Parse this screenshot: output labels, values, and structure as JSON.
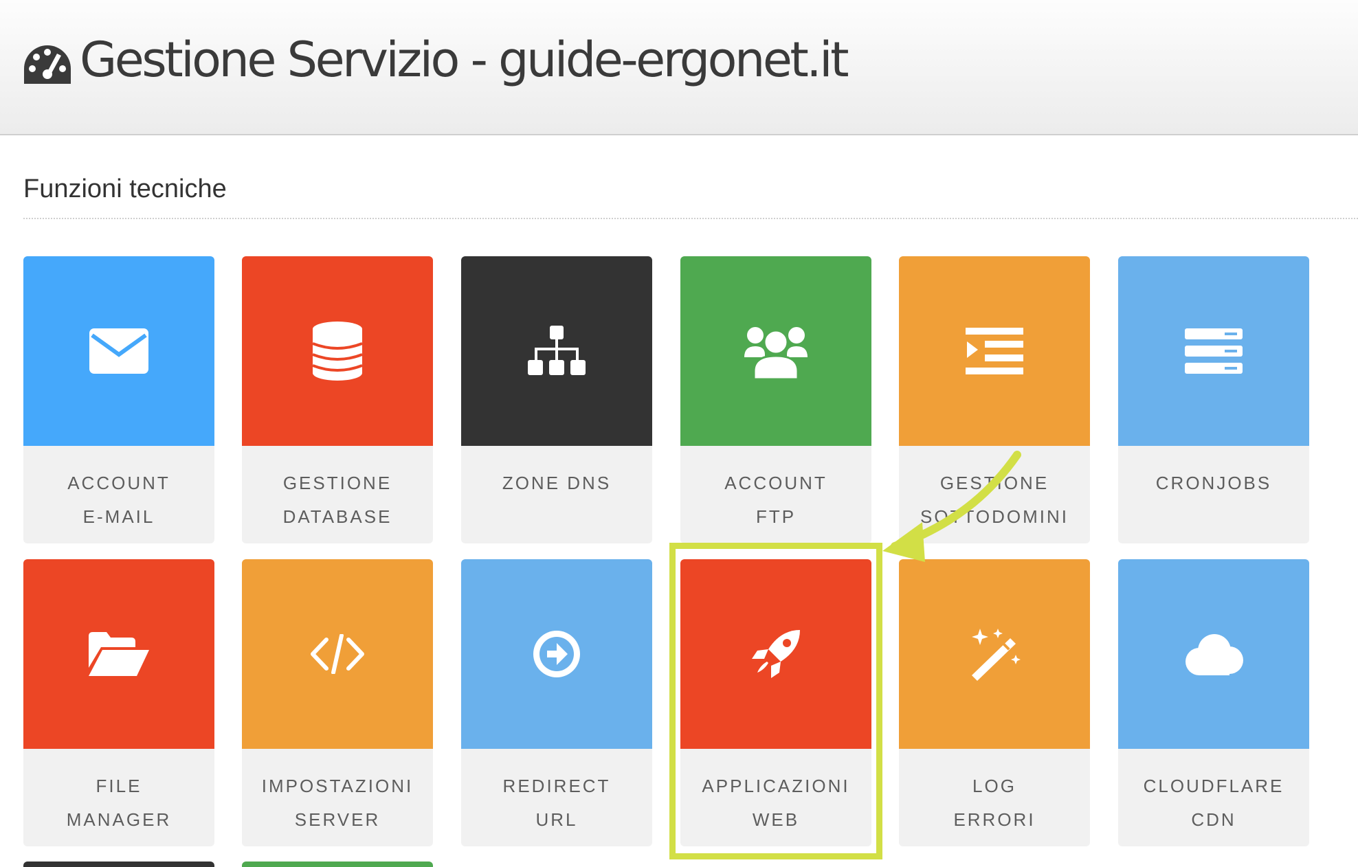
{
  "header": {
    "title": "Gestione Servizio - guide-ergonet.it",
    "icon": "dashboard-icon"
  },
  "section": {
    "title": "Funzioni tecniche"
  },
  "tiles": [
    {
      "id": "account-email",
      "icon": "envelope-icon",
      "color": "#45a8fb",
      "lines": [
        "ACCOUNT",
        "E-MAIL"
      ]
    },
    {
      "id": "gestione-database",
      "icon": "database-icon",
      "color": "#ec4625",
      "lines": [
        "GESTIONE",
        "DATABASE"
      ]
    },
    {
      "id": "zone-dns",
      "icon": "sitemap-icon",
      "color": "#333333",
      "lines": [
        "ZONE DNS",
        ""
      ]
    },
    {
      "id": "account-ftp",
      "icon": "users-icon",
      "color": "#4fa950",
      "lines": [
        "ACCOUNT",
        "FTP"
      ]
    },
    {
      "id": "gestione-sottodomini",
      "icon": "indent-icon",
      "color": "#f09f38",
      "lines": [
        "GESTIONE",
        "SOTTODOMINI"
      ]
    },
    {
      "id": "cronjobs",
      "icon": "server-icon",
      "color": "#6ab1ec",
      "lines": [
        "CRONJOBS",
        ""
      ]
    },
    {
      "id": "file-manager",
      "icon": "folder-open-icon",
      "color": "#ec4625",
      "lines": [
        "FILE",
        "MANAGER"
      ]
    },
    {
      "id": "impostazioni-server",
      "icon": "code-icon",
      "color": "#f09f38",
      "lines": [
        "IMPOSTAZIONI",
        "SERVER"
      ]
    },
    {
      "id": "redirect-url",
      "icon": "arrow-circle-right-icon",
      "color": "#6ab1ec",
      "lines": [
        "REDIRECT",
        "URL"
      ]
    },
    {
      "id": "applicazioni-web",
      "icon": "rocket-icon",
      "color": "#ec4625",
      "lines": [
        "APPLICAZIONI",
        "WEB"
      ]
    },
    {
      "id": "log-errori",
      "icon": "magic-wand-icon",
      "color": "#f09f38",
      "lines": [
        "LOG",
        "ERRORI"
      ]
    },
    {
      "id": "cloudflare-cdn",
      "icon": "cloud-icon",
      "color": "#6ab1ec",
      "lines": [
        "CLOUDFLARE",
        "CDN"
      ]
    }
  ],
  "partial_tiles": [
    {
      "color": "#333333"
    },
    {
      "color": "#4fa950"
    }
  ],
  "annotation": {
    "highlight_color": "#d2df46",
    "target": "applicazioni-web"
  }
}
